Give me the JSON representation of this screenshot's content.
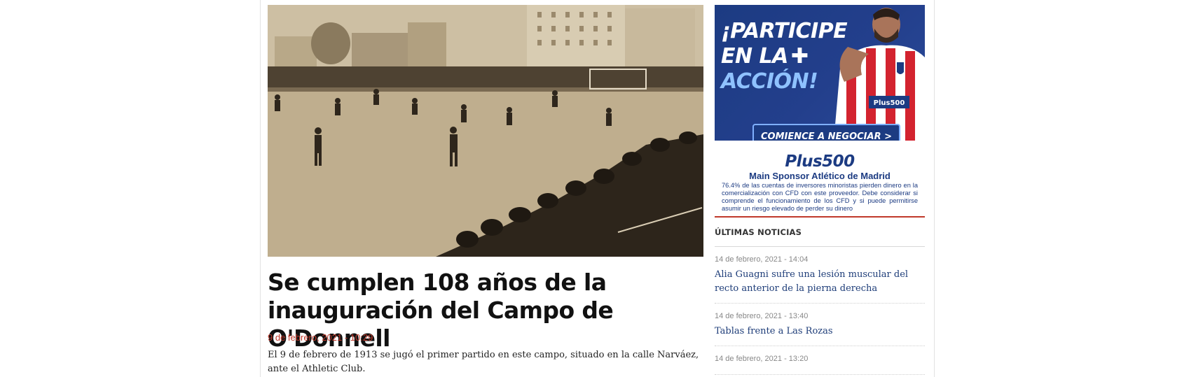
{
  "article": {
    "title": "Se cumplen 108 años de la inauguración del Campo de O'Donnell",
    "date": "9 de febrero, 2021 - 10:29",
    "lead": "El 9 de febrero de 1913 se jugó el primer partido en este campo, situado en la calle Narváez, ante el Athletic Club."
  },
  "ad": {
    "headline_line1": "¡PARTICIPE",
    "headline_line2": "EN LA",
    "headline_line3": "ACCIÓN!",
    "cta_label": "COMIENCE A NEGOCIAR >",
    "shirt_text": "Plus500"
  },
  "sponsor": {
    "logo_text": "Plus500",
    "title": "Main Sponsor Atlético de Madrid",
    "disclaimer": "76.4% de las cuentas de inversores minoristas pierden dinero en la comercialización con CFD con este proveedor. Debe considerar si comprende el funcionamiento de los CFD y si puede permitirse asumir un riesgo elevado de perder su dinero"
  },
  "latest_news": {
    "header": "ÚLTIMAS NOTICIAS",
    "items": [
      {
        "date": "14 de febrero, 2021 - 14:04",
        "title": "Alia Guagni sufre una lesión muscular del recto anterior de la pierna derecha"
      },
      {
        "date": "14 de febrero, 2021 - 13:40",
        "title": "Tablas frente a Las Rozas"
      },
      {
        "date": "14 de febrero, 2021 - 13:20",
        "title": ""
      }
    ]
  },
  "colors": {
    "accent_red": "#c0392b",
    "ad_blue": "#1c3b82",
    "link_blue": "#1d3c78"
  }
}
